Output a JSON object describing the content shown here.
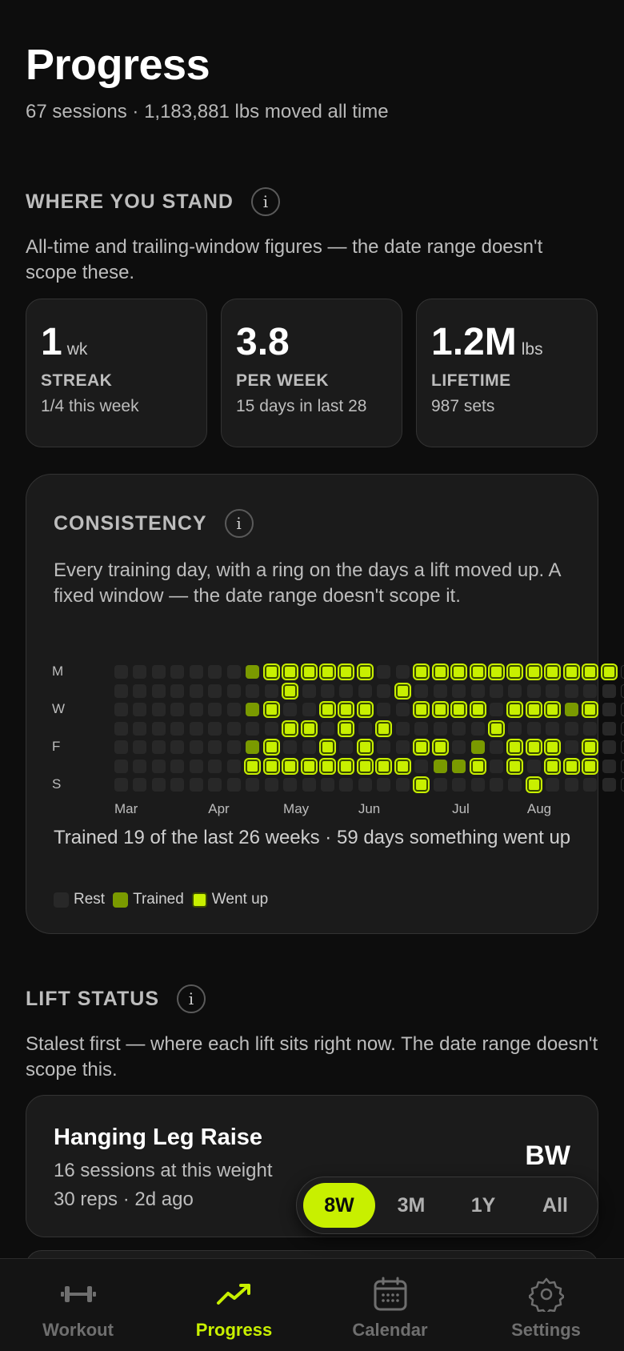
{
  "header": {
    "title": "Progress",
    "subtitle": "67 sessions · 1,183,881 lbs moved all time"
  },
  "where_you_stand": {
    "label": "WHERE YOU STAND",
    "description": "All-time and trailing-window figures — the date range doesn't scope these.",
    "stats": [
      {
        "value": "1",
        "unit": "wk",
        "label": "STREAK",
        "sub": "1/4 this week"
      },
      {
        "value": "3.8",
        "unit": "",
        "label": "PER WEEK",
        "sub": "15 days in last 28"
      },
      {
        "value": "1.2M",
        "unit": "lbs",
        "label": "LIFETIME",
        "sub": "987 sets"
      }
    ]
  },
  "consistency": {
    "label": "CONSISTENCY",
    "description": "Every training day, with a ring on the days a lift moved up. A fixed window — the date range doesn't scope it.",
    "day_labels": [
      "M",
      "",
      "W",
      "",
      "F",
      "",
      "S"
    ],
    "month_labels": [
      {
        "text": "Mar",
        "col": 0
      },
      {
        "text": "Apr",
        "col": 5
      },
      {
        "text": "May",
        "col": 9
      },
      {
        "text": "Jun",
        "col": 13
      },
      {
        "text": "Jul",
        "col": 18
      },
      {
        "text": "Aug",
        "col": 22
      }
    ],
    "grid": [
      [
        0,
        0,
        0,
        0,
        0,
        0,
        0,
        1,
        2,
        2,
        2,
        2,
        2,
        2,
        0,
        0,
        2,
        2,
        2,
        2,
        2,
        2,
        2,
        2,
        2,
        2,
        2,
        3
      ],
      [
        0,
        0,
        0,
        0,
        0,
        0,
        0,
        0,
        0,
        2,
        0,
        0,
        0,
        0,
        0,
        2,
        0,
        0,
        0,
        0,
        0,
        0,
        0,
        0,
        0,
        0,
        0,
        3
      ],
      [
        0,
        0,
        0,
        0,
        0,
        0,
        0,
        1,
        2,
        0,
        0,
        2,
        2,
        2,
        0,
        0,
        2,
        2,
        2,
        2,
        0,
        2,
        2,
        2,
        1,
        2,
        0,
        3
      ],
      [
        0,
        0,
        0,
        0,
        0,
        0,
        0,
        0,
        0,
        2,
        2,
        0,
        2,
        0,
        2,
        0,
        0,
        0,
        0,
        0,
        2,
        0,
        0,
        0,
        0,
        0,
        0,
        3
      ],
      [
        0,
        0,
        0,
        0,
        0,
        0,
        0,
        1,
        2,
        0,
        0,
        2,
        0,
        2,
        0,
        0,
        2,
        2,
        0,
        1,
        0,
        2,
        2,
        2,
        0,
        2,
        0,
        3
      ],
      [
        0,
        0,
        0,
        0,
        0,
        0,
        0,
        2,
        2,
        2,
        2,
        2,
        2,
        2,
        2,
        2,
        0,
        1,
        1,
        2,
        0,
        2,
        0,
        2,
        2,
        2,
        0,
        3
      ],
      [
        0,
        0,
        0,
        0,
        0,
        0,
        0,
        0,
        0,
        0,
        0,
        0,
        0,
        0,
        0,
        0,
        2,
        0,
        0,
        0,
        0,
        0,
        2,
        0,
        0,
        0,
        0,
        3
      ]
    ],
    "summary": "Trained 19 of the last 26 weeks · 59 days something went up",
    "legend": [
      {
        "label": "Rest",
        "color": "#282828"
      },
      {
        "label": "Trained",
        "color": "#7a9a00"
      },
      {
        "label": "Went up",
        "color": "#c8f000"
      }
    ]
  },
  "lift_status": {
    "label": "LIFT STATUS",
    "description": "Stalest first — where each lift sits right now. The date range doesn't scope this.",
    "lifts": [
      {
        "name": "Hanging Leg Raise",
        "sub1": "16 sessions at this weight",
        "sub2": "30 reps · 2d ago",
        "value": "BW"
      }
    ]
  },
  "range_selector": {
    "options": [
      "8W",
      "3M",
      "1Y",
      "All"
    ],
    "selected": "8W"
  },
  "tabbar": {
    "tabs": [
      {
        "label": "Workout",
        "icon": "dumbbell-icon"
      },
      {
        "label": "Progress",
        "icon": "trend-up-icon"
      },
      {
        "label": "Calendar",
        "icon": "calendar-icon"
      },
      {
        "label": "Settings",
        "icon": "gear-icon"
      }
    ],
    "active": "Progress"
  },
  "colors": {
    "accent": "#c8f000",
    "trained": "#7a9a00",
    "rest": "#282828",
    "background": "#0d0d0d",
    "card": "#1b1b1b"
  }
}
